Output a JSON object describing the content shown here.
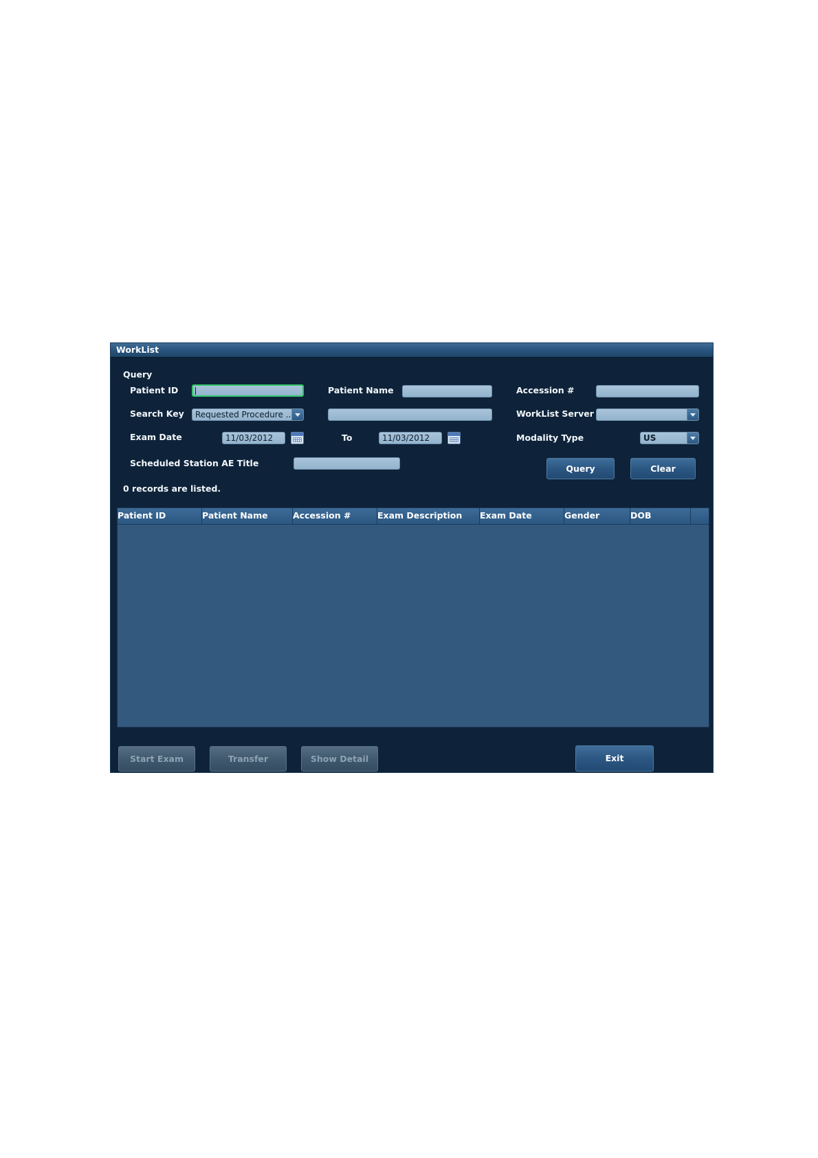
{
  "window": {
    "title": "WorkList"
  },
  "query": {
    "section_label": "Query",
    "patient_id_label": "Patient ID",
    "patient_id_value": "",
    "patient_name_label": "Patient Name",
    "patient_name_value": "",
    "accession_label": "Accession #",
    "accession_value": "",
    "search_key_label": "Search Key",
    "search_key_value": "Requested Procedure ...",
    "search_key_text": "",
    "worklist_server_label": "WorkList Server",
    "worklist_server_value": "",
    "exam_date_label": "Exam Date",
    "exam_date_from": "11/03/2012",
    "to_label": "To",
    "exam_date_to": "11/03/2012",
    "modality_type_label": "Modality Type",
    "modality_type_value": "US",
    "scheduled_station_label": "Scheduled Station AE Title",
    "scheduled_station_value": "",
    "query_button": "Query",
    "clear_button": "Clear"
  },
  "status": {
    "records_text": "0 records are listed."
  },
  "table": {
    "columns": [
      "Patient ID",
      "Patient Name",
      "Accession #",
      "Exam Description",
      "Exam Date",
      "Gender",
      "DOB"
    ],
    "rows": []
  },
  "footer": {
    "start_exam": "Start Exam",
    "transfer": "Transfer",
    "show_detail": "Show Detail",
    "exit": "Exit"
  },
  "icons": {
    "calendar": "calendar-icon",
    "dropdown": "chevron-down-icon"
  },
  "colors": {
    "dialog_bg": "#0e2339",
    "table_bg": "#33597f",
    "focus_border": "#33c46a"
  }
}
